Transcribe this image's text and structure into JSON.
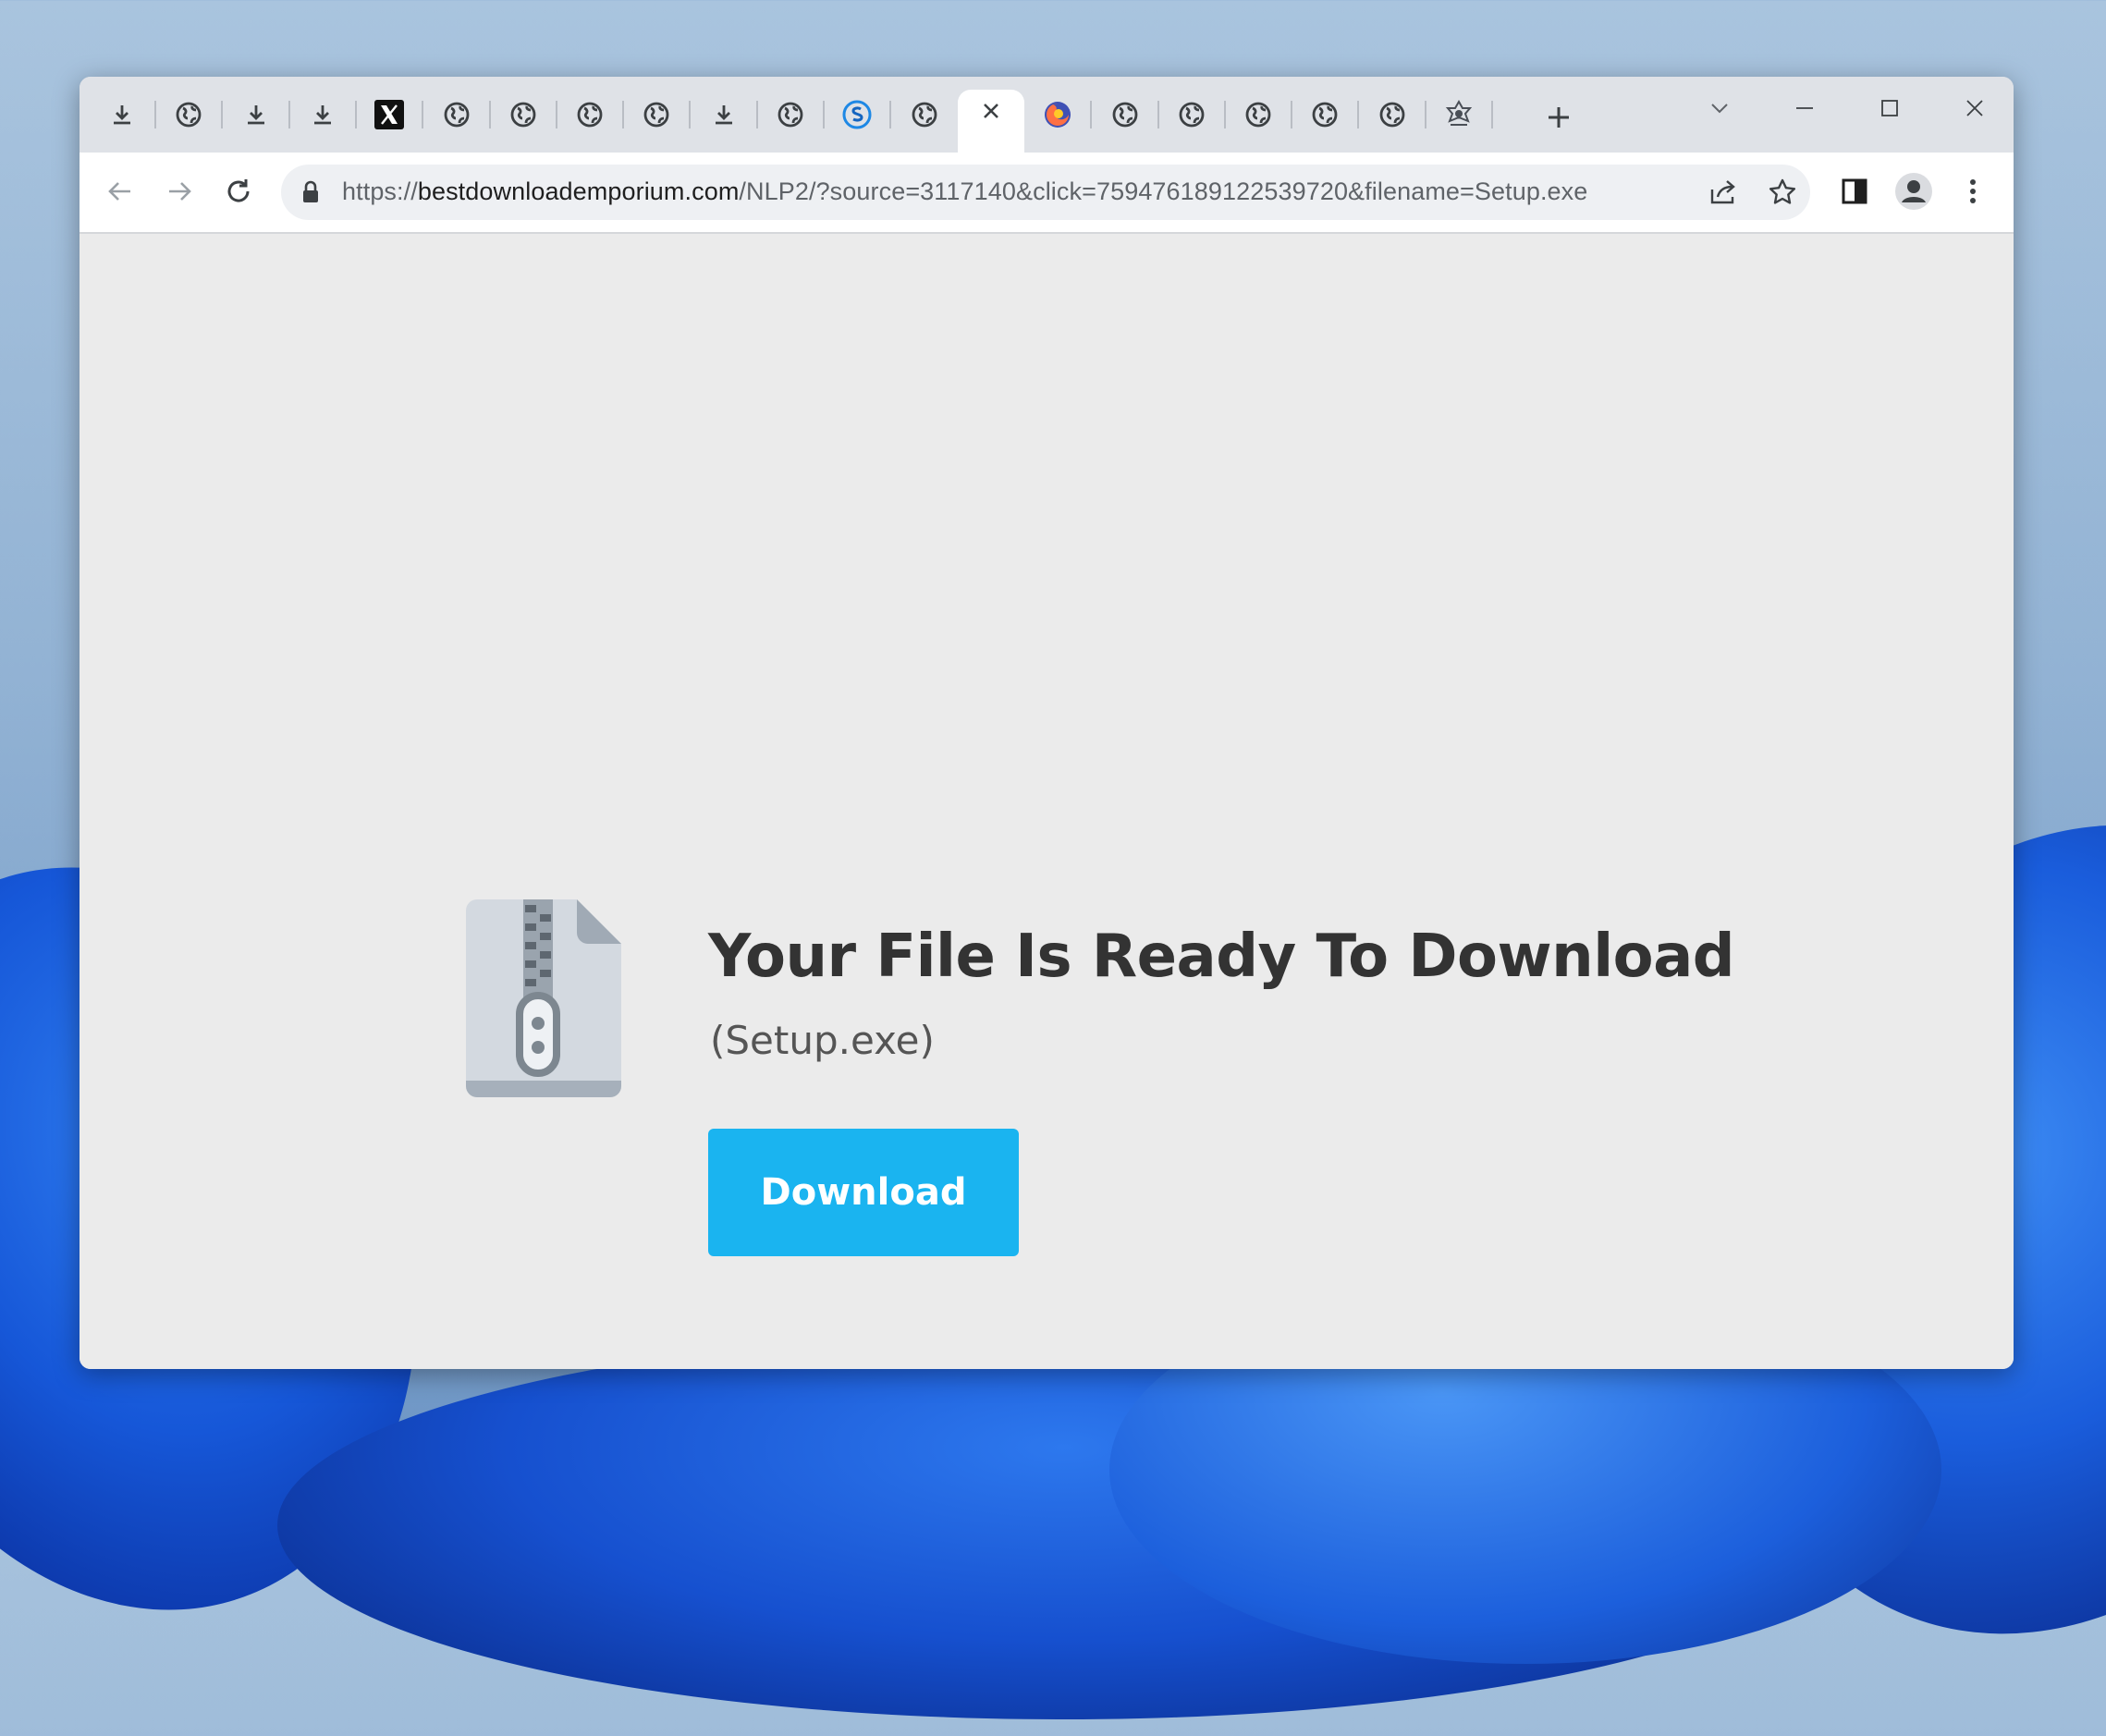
{
  "browser": {
    "tabs": [
      {
        "favicon": "download-icon"
      },
      {
        "favicon": "globe-icon"
      },
      {
        "favicon": "download-icon"
      },
      {
        "favicon": "download-icon"
      },
      {
        "favicon": "x-logo-icon"
      },
      {
        "favicon": "globe-icon"
      },
      {
        "favicon": "globe-icon"
      },
      {
        "favicon": "globe-icon"
      },
      {
        "favicon": "globe-icon"
      },
      {
        "favicon": "download-icon"
      },
      {
        "favicon": "globe-icon"
      },
      {
        "favicon": "swirl-s-icon"
      },
      {
        "favicon": "globe-icon"
      },
      {
        "favicon": "close-icon",
        "active": true
      },
      {
        "favicon": "firefox-like-icon"
      },
      {
        "favicon": "globe-icon"
      },
      {
        "favicon": "globe-icon"
      },
      {
        "favicon": "globe-icon"
      },
      {
        "favicon": "globe-icon"
      },
      {
        "favicon": "globe-icon"
      },
      {
        "favicon": "emblem-icon"
      }
    ],
    "address_bar": {
      "scheme": "https://",
      "host": "bestdownloademporium.com",
      "path": "/NLP2/?source=3117140&click=759476189122539720&filename=Setup.exe"
    }
  },
  "page": {
    "heading": "Your File Is Ready To Download",
    "filename": "(Setup.exe)",
    "download_label": "Download",
    "accent_color": "#1ab4f0"
  }
}
